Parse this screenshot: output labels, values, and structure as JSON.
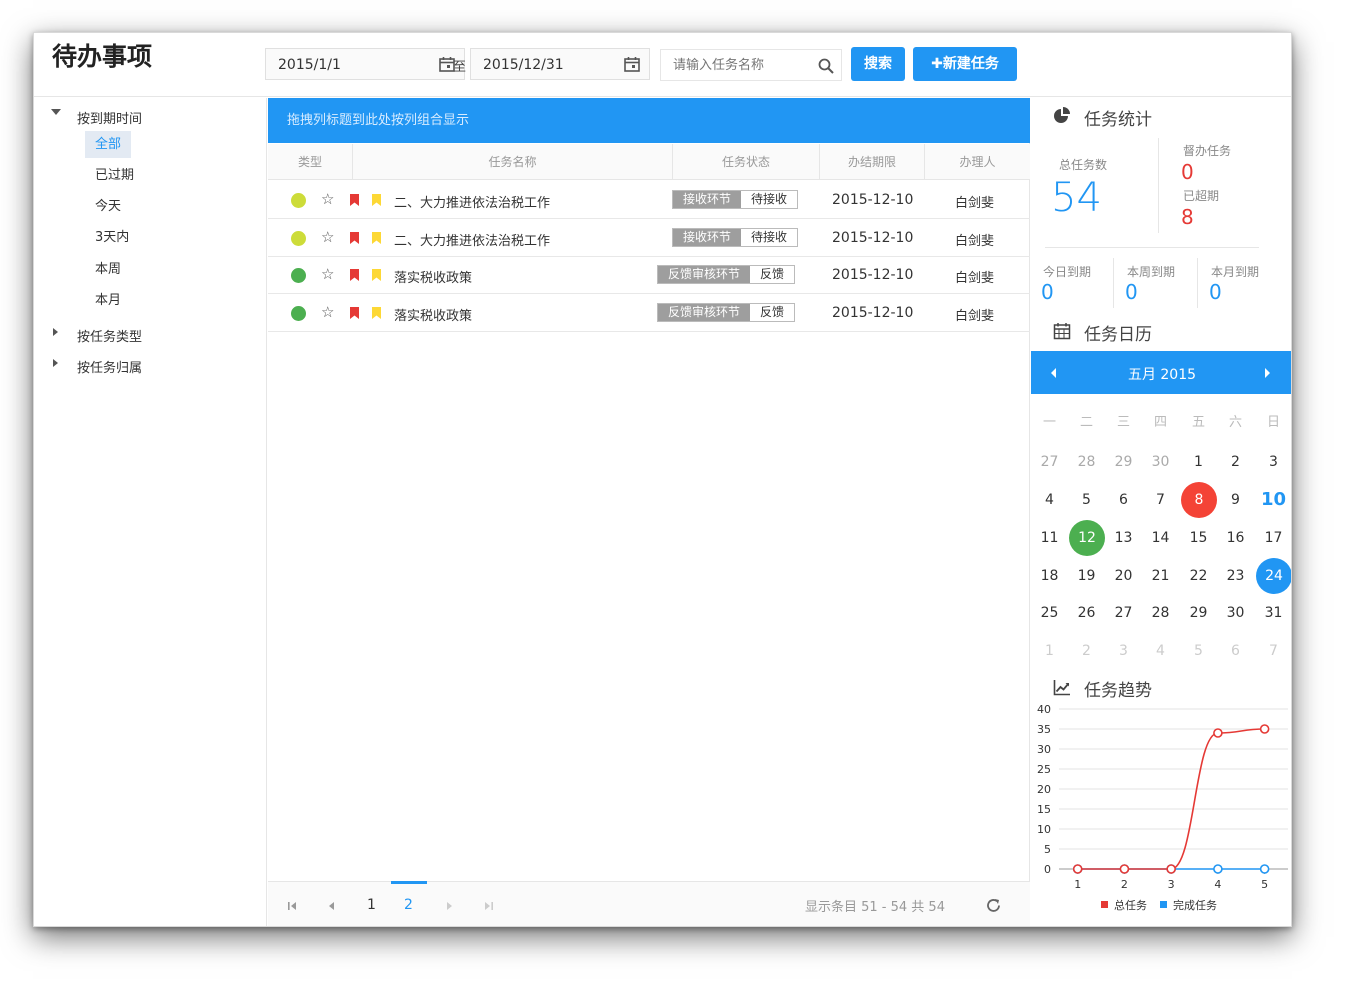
{
  "app": {
    "title": "待办事项"
  },
  "filters": {
    "start_date": "2015/1/1",
    "to_label": "至",
    "end_date": "2015/12/31",
    "search_placeholder": "请输入任务名称",
    "search_label": "搜索",
    "new_task_label": "✚新建任务"
  },
  "sidebar": {
    "groups": [
      {
        "label": "按到期时间",
        "expanded": true
      },
      {
        "label": "按任务类型",
        "expanded": false
      },
      {
        "label": "按任务归属",
        "expanded": false
      }
    ],
    "items": [
      {
        "label": "全部",
        "active": true
      },
      {
        "label": "已过期"
      },
      {
        "label": "今天"
      },
      {
        "label": "3天内"
      },
      {
        "label": "本周"
      },
      {
        "label": "本月"
      }
    ]
  },
  "grid": {
    "group_hint": "拖拽列标题到此处按列组合显示",
    "columns": [
      "类型",
      "任务名称",
      "任务状态",
      "办结期限",
      "办理人"
    ],
    "rows": [
      {
        "dot": "#cddc39",
        "name": "二、大力推进依法治税工作",
        "stage": "接收环节",
        "state": "待接收",
        "deadline": "2015-12-10",
        "owner": "白剑斐"
      },
      {
        "dot": "#cddc39",
        "name": "二、大力推进依法治税工作",
        "stage": "接收环节",
        "state": "待接收",
        "deadline": "2015-12-10",
        "owner": "白剑斐"
      },
      {
        "dot": "#4caf50",
        "name": "落实税收政策",
        "stage": "反馈审核环节",
        "state": "反馈",
        "deadline": "2015-12-10",
        "owner": "白剑斐"
      },
      {
        "dot": "#4caf50",
        "name": "落实税收政策",
        "stage": "反馈审核环节",
        "state": "反馈",
        "deadline": "2015-12-10",
        "owner": "白剑斐"
      }
    ],
    "star_glyph": "☆",
    "flag_colors": [
      "#e53935",
      "#fdd835"
    ]
  },
  "pager": {
    "pages": [
      "1",
      "2"
    ],
    "current": "2",
    "summary": "显示条目 51 - 54 共 54"
  },
  "stats": {
    "title": "任务统计",
    "total_label": "总任务数",
    "total": "54",
    "supervise_label": "督办任务",
    "supervise": "0",
    "overdue_label": "已超期",
    "overdue": "8",
    "today_label": "今日到期",
    "today": "0",
    "week_label": "本周到期",
    "week": "0",
    "month_label": "本月到期",
    "month": "0"
  },
  "calendar": {
    "title": "任务日历",
    "month": "五月 2015",
    "weekdays": [
      "一",
      "二",
      "三",
      "四",
      "五",
      "六",
      "日"
    ],
    "weeks": [
      [
        "27",
        "28",
        "29",
        "30",
        "1",
        "2",
        "3"
      ],
      [
        "4",
        "5",
        "6",
        "7",
        "8",
        "9",
        "10"
      ],
      [
        "11",
        "12",
        "13",
        "14",
        "15",
        "16",
        "17"
      ],
      [
        "18",
        "19",
        "20",
        "21",
        "22",
        "23",
        "24"
      ],
      [
        "25",
        "26",
        "27",
        "28",
        "29",
        "30",
        "31"
      ],
      [
        "1",
        "2",
        "3",
        "4",
        "5",
        "6",
        "7"
      ]
    ],
    "highlight_red": "8",
    "highlight_green": "12",
    "highlight_blue": "24",
    "today": "10"
  },
  "trend": {
    "title": "任务趋势"
  },
  "chart_data": {
    "type": "line",
    "x": [
      1,
      2,
      3,
      4,
      5
    ],
    "series": [
      {
        "name": "总任务",
        "values": [
          0,
          0,
          0,
          34,
          35
        ],
        "color": "#e53935"
      },
      {
        "name": "完成任务",
        "values": [
          0,
          0,
          0,
          0,
          0
        ],
        "color": "#2196f3"
      }
    ],
    "ylim": [
      0,
      40
    ],
    "yticks": [
      0,
      5,
      10,
      15,
      20,
      25,
      30,
      35,
      40
    ],
    "grid": true,
    "legend": "bottom"
  }
}
